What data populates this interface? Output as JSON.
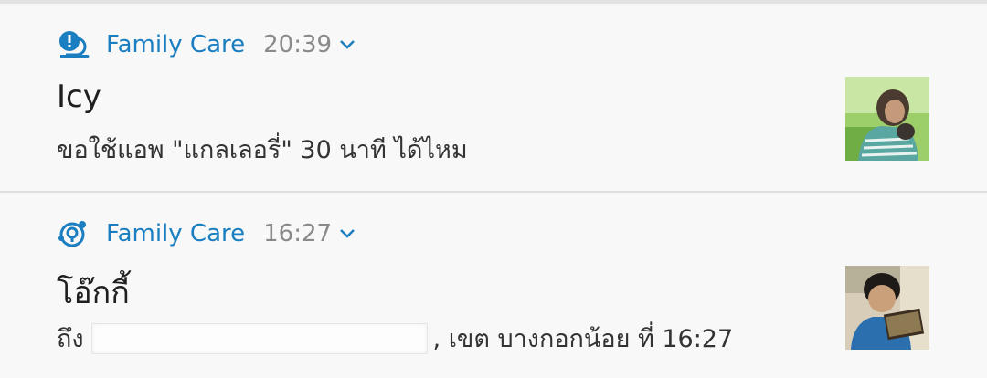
{
  "notifications": [
    {
      "app_name": "Family Care",
      "time": "20:39",
      "app_icon": "family-care-alert-icon",
      "title": "Icy",
      "body": "ขอใช้แอพ \"แกลเลอรี่\" 30 นาที ได้ไหม",
      "thumbnail": "avatar-photo-icy"
    },
    {
      "app_name": "Family Care",
      "time": "16:27",
      "app_icon": "family-care-location-icon",
      "title": "โอ๊กกี้",
      "body_prefix": "ถึง",
      "body_suffix": ", เขต บางกอกน้อย ที่ 16:27",
      "thumbnail": "avatar-photo-oakky"
    }
  ],
  "colors": {
    "accent": "#1a7ec1",
    "time": "#8a8a8a",
    "background": "#f8f8f8"
  }
}
